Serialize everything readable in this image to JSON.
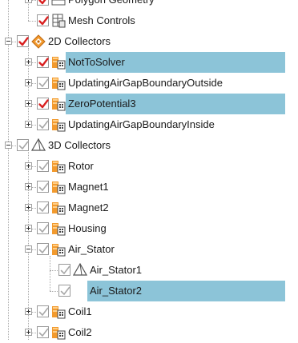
{
  "tree": {
    "rows": [
      {
        "label": "Polygon Geometry",
        "level": 1,
        "expander": "plus",
        "check": "red",
        "icon": "polygon-geometry-icon",
        "selected": false
      },
      {
        "label": "Mesh Controls",
        "level": 1,
        "expander": "none",
        "check": "red",
        "icon": "mesh-controls-icon",
        "selected": false
      },
      {
        "label": "2D Collectors",
        "level": 0,
        "expander": "minus",
        "check": "red",
        "icon": "collector-2d-icon",
        "selected": false
      },
      {
        "label": "NotToSolver",
        "level": 1,
        "expander": "plus",
        "check": "red",
        "icon": "component-icon",
        "selected": true
      },
      {
        "label": "UpdatingAirGapBoundaryOutside",
        "level": 1,
        "expander": "plus",
        "check": "gray",
        "icon": "component-icon",
        "selected": false
      },
      {
        "label": "ZeroPotential3",
        "level": 1,
        "expander": "plus",
        "check": "red",
        "icon": "component-icon",
        "selected": true
      },
      {
        "label": "UpdatingAirGapBoundaryInside",
        "level": 1,
        "expander": "plus",
        "check": "gray",
        "icon": "component-icon",
        "selected": false
      },
      {
        "label": "3D Collectors",
        "level": 0,
        "expander": "minus",
        "check": "gray",
        "icon": "collector-3d-icon",
        "selected": false
      },
      {
        "label": "Rotor",
        "level": 1,
        "expander": "plus",
        "check": "gray",
        "icon": "component-icon",
        "selected": false
      },
      {
        "label": "Magnet1",
        "level": 1,
        "expander": "plus",
        "check": "gray",
        "icon": "component-icon",
        "selected": false
      },
      {
        "label": "Magnet2",
        "level": 1,
        "expander": "plus",
        "check": "gray",
        "icon": "component-icon",
        "selected": false
      },
      {
        "label": "Housing",
        "level": 1,
        "expander": "plus",
        "check": "gray",
        "icon": "component-icon",
        "selected": false
      },
      {
        "label": "Air_Stator",
        "level": 1,
        "expander": "minus",
        "check": "gray",
        "icon": "component-icon",
        "selected": false
      },
      {
        "label": "Air_Stator1",
        "level": 2,
        "expander": "none",
        "check": "gray",
        "icon": "collector-3d-icon",
        "selected": false
      },
      {
        "label": "Air_Stator2",
        "level": 2,
        "expander": "none",
        "check": "gray",
        "icon": "none",
        "selected": true
      },
      {
        "label": "Coil1",
        "level": 1,
        "expander": "plus",
        "check": "gray",
        "icon": "component-icon",
        "selected": false
      },
      {
        "label": "Coil2",
        "level": 1,
        "expander": "plus",
        "check": "gray",
        "icon": "component-icon",
        "selected": false
      }
    ]
  },
  "colors": {
    "selection": "#8cc4d8",
    "check_red": "#d92020",
    "check_gray": "#a8a8a8",
    "connector": "#a8a8a8"
  }
}
